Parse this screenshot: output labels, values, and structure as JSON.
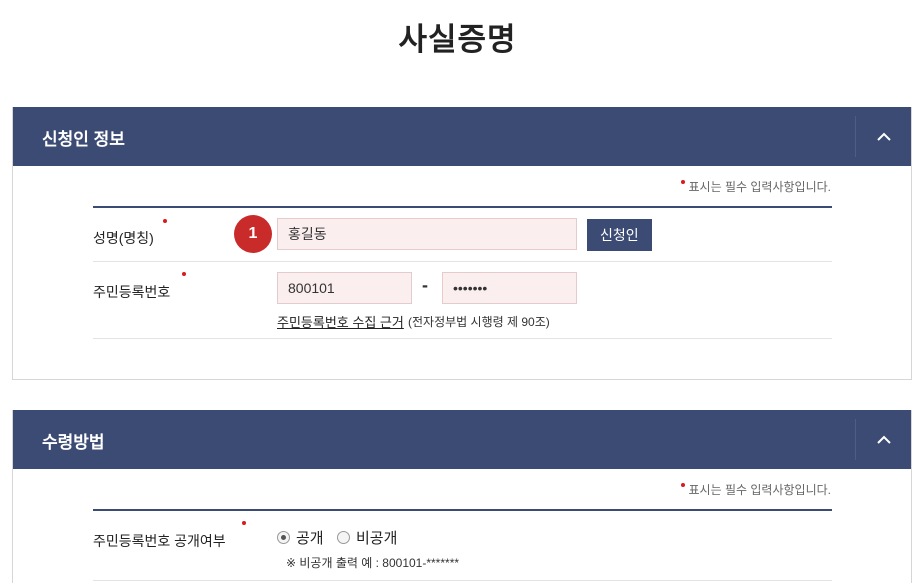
{
  "page": {
    "title": "사실증명"
  },
  "applicant_section": {
    "title": "신청인 정보",
    "required_note": "표시는 필수 입력사항입니다.",
    "name_label": "성명(명칭)",
    "step_number": "1",
    "name_value": "홍길동",
    "applicant_button": "신청인",
    "rrn_label": "주민등록번호",
    "rrn_front": "800101",
    "rrn_separator": "-",
    "rrn_back": "•••••••",
    "collection_link": "주민등록번호 수집 근거",
    "law_note": "(전자정부법 시행령 제 90조)"
  },
  "receipt_section": {
    "title": "수령방법",
    "required_note": "표시는 필수 입력사항입니다.",
    "disclosure_label": "주민등록번호 공개여부",
    "options": {
      "public": "공개",
      "private": "비공개"
    },
    "selected": "공개",
    "example_note": "※ 비공개 출력 예 : 800101-*******"
  },
  "colors": {
    "header_bg": "#3c4b74",
    "input_bg": "#fbeeee",
    "required_dot": "#d61c1c",
    "badge": "#c92b2b"
  },
  "icons": {
    "collapse": "chevron-up-icon",
    "required": "required-dot-icon"
  }
}
